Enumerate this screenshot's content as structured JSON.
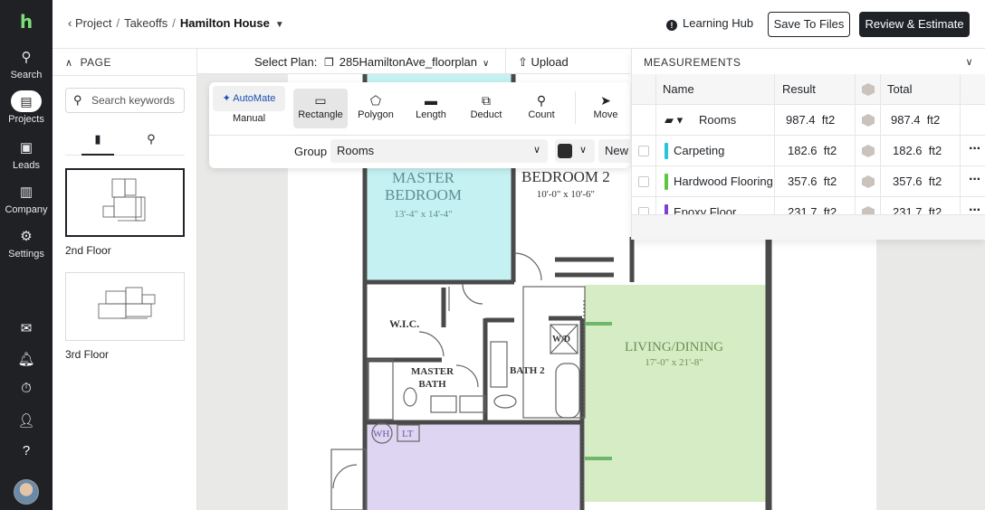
{
  "rail": {
    "logo": "h",
    "items": [
      {
        "label": "Search",
        "icon": "search-icon",
        "glyph": "⚲"
      },
      {
        "label": "Projects",
        "icon": "projects-icon",
        "glyph": "▤"
      },
      {
        "label": "Leads",
        "icon": "leads-icon",
        "glyph": "▣"
      },
      {
        "label": "Company",
        "icon": "company-icon",
        "glyph": "▥"
      },
      {
        "label": "Settings",
        "icon": "settings-icon",
        "glyph": "⚙"
      }
    ],
    "bottom_icons": [
      "inbox-icon",
      "bell-icon",
      "timer-icon",
      "user-settings-icon",
      "help-icon"
    ]
  },
  "header": {
    "breadcrumb": [
      "Project",
      "Takeoffs",
      "Hamilton House"
    ],
    "learning_hub": "Learning Hub",
    "save_files": "Save To Files",
    "review_estimate": "Review & Estimate"
  },
  "page_panel": {
    "title": "PAGE",
    "search_placeholder": "Search keywords",
    "pages": [
      {
        "label": "2nd Floor",
        "selected": true
      },
      {
        "label": "3rd Floor",
        "selected": false
      }
    ]
  },
  "plan_bar": {
    "select_label": "Select Plan:",
    "plan_file": "285HamiltonAve_floorplan",
    "upload": "Upload"
  },
  "tools": {
    "automate": "✦ AutoMate",
    "manual": "Manual",
    "items": [
      {
        "label": "Rectangle",
        "glyph": "▭",
        "active": true
      },
      {
        "label": "Polygon",
        "glyph": "⬠",
        "active": false
      },
      {
        "label": "Length",
        "glyph": "▬",
        "active": false
      },
      {
        "label": "Deduct",
        "glyph": "⧉",
        "active": false
      },
      {
        "label": "Count",
        "glyph": "⚲",
        "active": false
      },
      {
        "label": "Move",
        "glyph": "➤",
        "active": false
      }
    ],
    "group_label": "Group",
    "group_value": "Rooms",
    "new_label": "New",
    "color": "#2b2b2b"
  },
  "measurements": {
    "title": "MEASUREMENTS",
    "columns": [
      "Name",
      "Result",
      "Total"
    ],
    "rows": [
      {
        "name": "Rooms",
        "result": "987.4",
        "unit": "ft2",
        "total": "987.4",
        "total_unit": "ft2",
        "color": null,
        "group": true
      },
      {
        "name": "Carpeting",
        "result": "182.6",
        "unit": "ft2",
        "total": "182.6",
        "total_unit": "ft2",
        "color": "#29c4d9",
        "group": false
      },
      {
        "name": "Hardwood Flooring",
        "result": "357.6",
        "unit": "ft2",
        "total": "357.6",
        "total_unit": "ft2",
        "color": "#5cc73c",
        "group": false
      },
      {
        "name": "Epoxy Floor",
        "result": "231.7",
        "unit": "ft2",
        "total": "231.7",
        "total_unit": "ft2",
        "color": "#7b3fd6",
        "group": false
      }
    ]
  },
  "floorplan": {
    "rooms": [
      {
        "name": "MASTER",
        "name2": "BEDROOM",
        "dims": "13'-4\" x 14'-4\""
      },
      {
        "name": "BEDROOM 2",
        "dims": "10'-0\" x 10'-6\""
      },
      {
        "name": "W.I.C."
      },
      {
        "name": "MASTER",
        "name2": "BATH"
      },
      {
        "name": "BATH 2"
      },
      {
        "name": "W/D"
      },
      {
        "name": "LIVING/DINING",
        "dims": "17'-0\" x 21'-8\""
      },
      {
        "name": "WH"
      },
      {
        "name": "LT"
      }
    ],
    "colors": {
      "bedroom": "#c6f1f3",
      "living": "#d6ecc4",
      "epoxy": "#ddd5f2",
      "wall": "#4a4a4a"
    }
  }
}
